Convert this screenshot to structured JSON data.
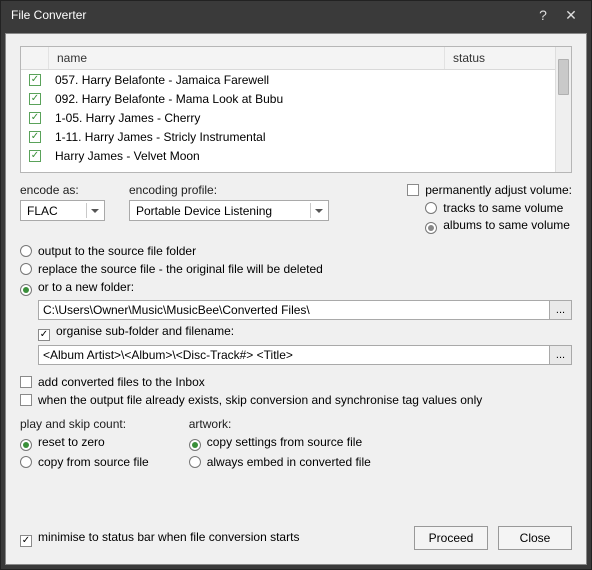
{
  "window": {
    "title": "File Converter"
  },
  "table": {
    "headers": {
      "name": "name",
      "status": "status"
    },
    "rows": [
      {
        "checked": true,
        "name": "057. Harry Belafonte - Jamaica Farewell"
      },
      {
        "checked": true,
        "name": "092. Harry Belafonte - Mama Look at Bubu"
      },
      {
        "checked": true,
        "name": "1-05. Harry James - Cherry"
      },
      {
        "checked": true,
        "name": "1-11. Harry James - Stricly Instrumental"
      },
      {
        "checked": true,
        "name": "Harry James - Velvet Moon"
      }
    ]
  },
  "encode": {
    "encode_as_label": "encode as:",
    "encode_as_value": "FLAC",
    "profile_label": "encoding profile:",
    "profile_value": "Portable Device Listening"
  },
  "volume": {
    "adjust_label": "permanently adjust volume:",
    "tracks_label": "tracks to same volume",
    "albums_label": "albums to same volume"
  },
  "output": {
    "source_label": "output to the source file folder",
    "replace_label": "replace the source file  - the original file will be deleted",
    "newfolder_label": "or to a new folder:",
    "path": "C:\\Users\\Owner\\Music\\MusicBee\\Converted Files\\",
    "organise_label": "organise sub-folder and filename:",
    "pattern": "<Album Artist>\\<Album>\\<Disc-Track#> <Title>"
  },
  "extra": {
    "inbox_label": "add converted files to the Inbox",
    "skip_label": "when the output file already exists, skip conversion and synchronise tag values only"
  },
  "playskip": {
    "heading": "play and skip count:",
    "reset": "reset to zero",
    "copy": "copy from source file"
  },
  "artwork": {
    "heading": "artwork:",
    "copy": "copy settings from source file",
    "embed": "always embed in converted file"
  },
  "footer": {
    "minimise": "minimise to status bar when file conversion starts",
    "proceed": "Proceed",
    "close": "Close"
  }
}
